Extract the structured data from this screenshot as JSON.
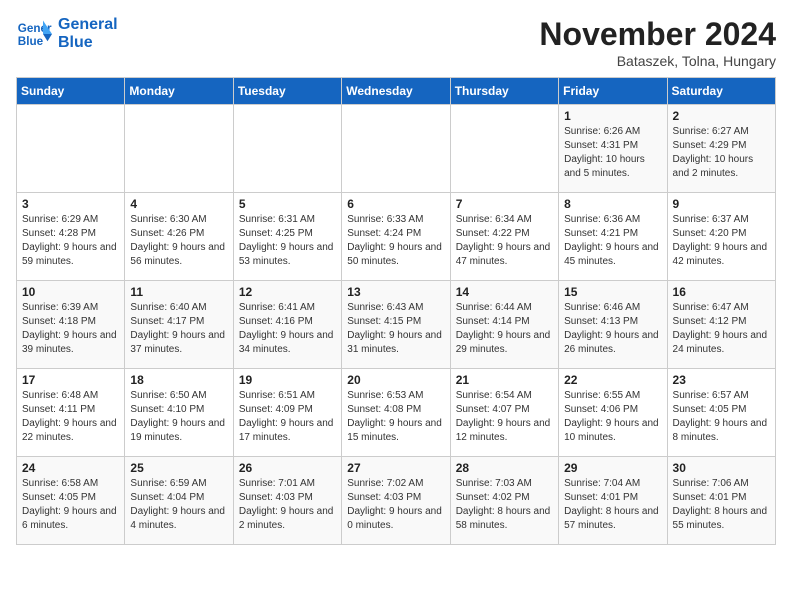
{
  "logo": {
    "line1": "General",
    "line2": "Blue"
  },
  "title": "November 2024",
  "subtitle": "Bataszek, Tolna, Hungary",
  "days_of_week": [
    "Sunday",
    "Monday",
    "Tuesday",
    "Wednesday",
    "Thursday",
    "Friday",
    "Saturday"
  ],
  "weeks": [
    [
      {
        "day": "",
        "info": ""
      },
      {
        "day": "",
        "info": ""
      },
      {
        "day": "",
        "info": ""
      },
      {
        "day": "",
        "info": ""
      },
      {
        "day": "",
        "info": ""
      },
      {
        "day": "1",
        "info": "Sunrise: 6:26 AM\nSunset: 4:31 PM\nDaylight: 10 hours and 5 minutes."
      },
      {
        "day": "2",
        "info": "Sunrise: 6:27 AM\nSunset: 4:29 PM\nDaylight: 10 hours and 2 minutes."
      }
    ],
    [
      {
        "day": "3",
        "info": "Sunrise: 6:29 AM\nSunset: 4:28 PM\nDaylight: 9 hours and 59 minutes."
      },
      {
        "day": "4",
        "info": "Sunrise: 6:30 AM\nSunset: 4:26 PM\nDaylight: 9 hours and 56 minutes."
      },
      {
        "day": "5",
        "info": "Sunrise: 6:31 AM\nSunset: 4:25 PM\nDaylight: 9 hours and 53 minutes."
      },
      {
        "day": "6",
        "info": "Sunrise: 6:33 AM\nSunset: 4:24 PM\nDaylight: 9 hours and 50 minutes."
      },
      {
        "day": "7",
        "info": "Sunrise: 6:34 AM\nSunset: 4:22 PM\nDaylight: 9 hours and 47 minutes."
      },
      {
        "day": "8",
        "info": "Sunrise: 6:36 AM\nSunset: 4:21 PM\nDaylight: 9 hours and 45 minutes."
      },
      {
        "day": "9",
        "info": "Sunrise: 6:37 AM\nSunset: 4:20 PM\nDaylight: 9 hours and 42 minutes."
      }
    ],
    [
      {
        "day": "10",
        "info": "Sunrise: 6:39 AM\nSunset: 4:18 PM\nDaylight: 9 hours and 39 minutes."
      },
      {
        "day": "11",
        "info": "Sunrise: 6:40 AM\nSunset: 4:17 PM\nDaylight: 9 hours and 37 minutes."
      },
      {
        "day": "12",
        "info": "Sunrise: 6:41 AM\nSunset: 4:16 PM\nDaylight: 9 hours and 34 minutes."
      },
      {
        "day": "13",
        "info": "Sunrise: 6:43 AM\nSunset: 4:15 PM\nDaylight: 9 hours and 31 minutes."
      },
      {
        "day": "14",
        "info": "Sunrise: 6:44 AM\nSunset: 4:14 PM\nDaylight: 9 hours and 29 minutes."
      },
      {
        "day": "15",
        "info": "Sunrise: 6:46 AM\nSunset: 4:13 PM\nDaylight: 9 hours and 26 minutes."
      },
      {
        "day": "16",
        "info": "Sunrise: 6:47 AM\nSunset: 4:12 PM\nDaylight: 9 hours and 24 minutes."
      }
    ],
    [
      {
        "day": "17",
        "info": "Sunrise: 6:48 AM\nSunset: 4:11 PM\nDaylight: 9 hours and 22 minutes."
      },
      {
        "day": "18",
        "info": "Sunrise: 6:50 AM\nSunset: 4:10 PM\nDaylight: 9 hours and 19 minutes."
      },
      {
        "day": "19",
        "info": "Sunrise: 6:51 AM\nSunset: 4:09 PM\nDaylight: 9 hours and 17 minutes."
      },
      {
        "day": "20",
        "info": "Sunrise: 6:53 AM\nSunset: 4:08 PM\nDaylight: 9 hours and 15 minutes."
      },
      {
        "day": "21",
        "info": "Sunrise: 6:54 AM\nSunset: 4:07 PM\nDaylight: 9 hours and 12 minutes."
      },
      {
        "day": "22",
        "info": "Sunrise: 6:55 AM\nSunset: 4:06 PM\nDaylight: 9 hours and 10 minutes."
      },
      {
        "day": "23",
        "info": "Sunrise: 6:57 AM\nSunset: 4:05 PM\nDaylight: 9 hours and 8 minutes."
      }
    ],
    [
      {
        "day": "24",
        "info": "Sunrise: 6:58 AM\nSunset: 4:05 PM\nDaylight: 9 hours and 6 minutes."
      },
      {
        "day": "25",
        "info": "Sunrise: 6:59 AM\nSunset: 4:04 PM\nDaylight: 9 hours and 4 minutes."
      },
      {
        "day": "26",
        "info": "Sunrise: 7:01 AM\nSunset: 4:03 PM\nDaylight: 9 hours and 2 minutes."
      },
      {
        "day": "27",
        "info": "Sunrise: 7:02 AM\nSunset: 4:03 PM\nDaylight: 9 hours and 0 minutes."
      },
      {
        "day": "28",
        "info": "Sunrise: 7:03 AM\nSunset: 4:02 PM\nDaylight: 8 hours and 58 minutes."
      },
      {
        "day": "29",
        "info": "Sunrise: 7:04 AM\nSunset: 4:01 PM\nDaylight: 8 hours and 57 minutes."
      },
      {
        "day": "30",
        "info": "Sunrise: 7:06 AM\nSunset: 4:01 PM\nDaylight: 8 hours and 55 minutes."
      }
    ]
  ]
}
